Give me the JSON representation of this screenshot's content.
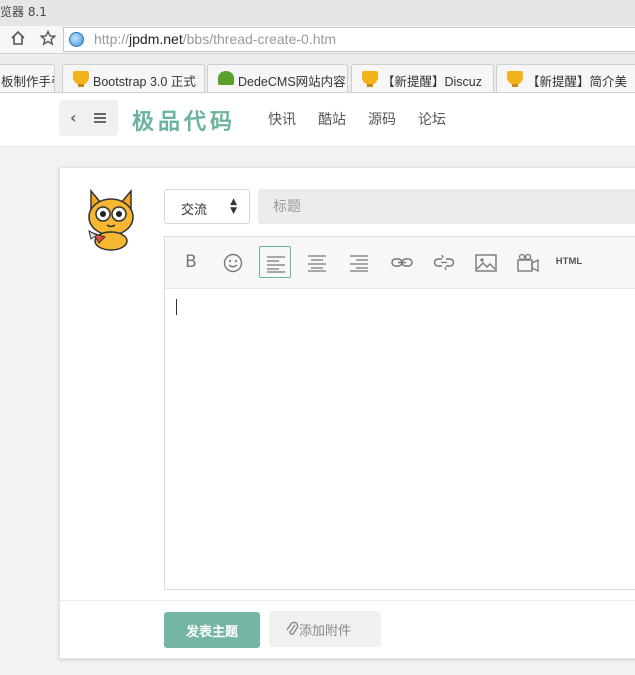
{
  "browser": {
    "title": "览器 8.1",
    "url_scheme": "http://",
    "url_host": "jpdm.net",
    "url_path": "/bbs/thread-create-0.htm",
    "tabs": [
      {
        "label": "板制作手引",
        "icon": "none"
      },
      {
        "label": "Bootstrap 3.0 正式",
        "icon": "trophy"
      },
      {
        "label": "DedeCMS网站内容",
        "icon": "dede"
      },
      {
        "label": "【新提醒】Discuz",
        "icon": "trophy"
      },
      {
        "label": "【新提醒】简介美",
        "icon": "trophy"
      }
    ]
  },
  "header": {
    "logo": "极品代码",
    "nav": [
      "快讯",
      "酷站",
      "源码",
      "论坛"
    ]
  },
  "form": {
    "forum_select": "交流",
    "title_placeholder": "标题",
    "toolbar": {
      "bold": "B",
      "html": "HTML",
      "icons": [
        "bold-icon",
        "emoji-icon",
        "align-left-icon",
        "align-center-icon",
        "align-right-icon",
        "link-icon",
        "unlink-icon",
        "image-icon",
        "video-icon",
        "html-icon"
      ]
    },
    "submit_label": "发表主题",
    "attach_label": "添加附件"
  },
  "colors": {
    "accent": "#6ab3a0",
    "submit": "#74b5a4"
  }
}
